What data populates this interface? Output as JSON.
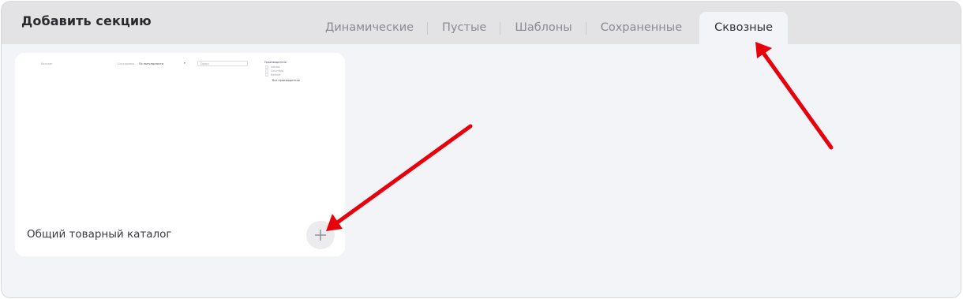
{
  "dialog": {
    "title": "Добавить секцию"
  },
  "tabs": [
    {
      "label": "Динамические",
      "active": false
    },
    {
      "label": "Пустые",
      "active": false
    },
    {
      "label": "Шаблоны",
      "active": false
    },
    {
      "label": "Сохраненные",
      "active": false
    },
    {
      "label": "Сквозные",
      "active": true
    }
  ],
  "card": {
    "label": "Общий товарный каталог",
    "add_icon": "plus-icon",
    "thumbnail": {
      "left_text": "Каталог",
      "sort_label": "Сортировка",
      "sort_value": "По популярности",
      "search_placeholder": "Поиск",
      "filter_title": "Производители",
      "filter_options": [
        "Adidas",
        "Columbia",
        "Reebok"
      ],
      "filter_action": "Все производители"
    }
  },
  "annotations": {
    "arrow_color": "#e8000b"
  }
}
